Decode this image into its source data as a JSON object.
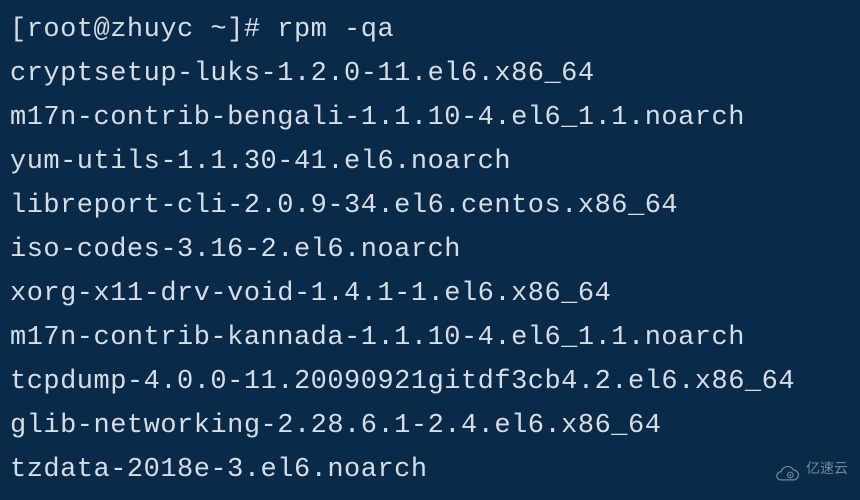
{
  "terminal": {
    "prompt": "[root@zhuyc ~]# ",
    "command": "rpm -qa",
    "output": [
      "cryptsetup-luks-1.2.0-11.el6.x86_64",
      "m17n-contrib-bengali-1.1.10-4.el6_1.1.noarch",
      "yum-utils-1.1.30-41.el6.noarch",
      "libreport-cli-2.0.9-34.el6.centos.x86_64",
      "iso-codes-3.16-2.el6.noarch",
      "xorg-x11-drv-void-1.4.1-1.el6.x86_64",
      "m17n-contrib-kannada-1.1.10-4.el6_1.1.noarch",
      "tcpdump-4.0.0-11.20090921gitdf3cb4.2.el6.x86_64",
      "glib-networking-2.28.6.1-2.4.el6.x86_64",
      "tzdata-2018e-3.el6.noarch"
    ]
  },
  "watermark": {
    "text": "亿速云"
  }
}
